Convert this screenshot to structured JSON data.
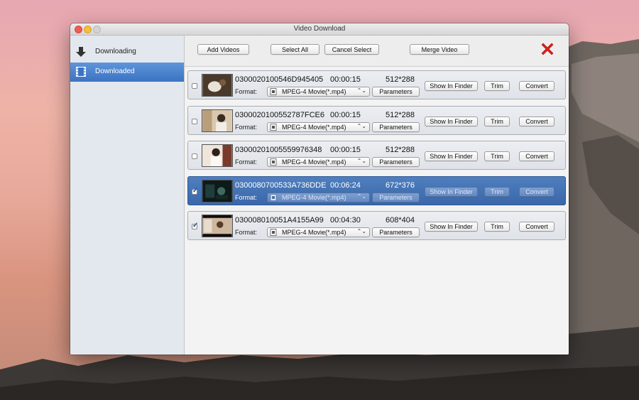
{
  "window": {
    "title": "Video Download"
  },
  "sidebar": {
    "items": [
      {
        "label": "Downloading",
        "icon": "download-arrow-icon"
      },
      {
        "label": "Downloaded",
        "icon": "film-icon"
      }
    ]
  },
  "toolbar": {
    "add_videos": "Add Videos",
    "select_all": "Select All",
    "cancel_select": "Cancel Select",
    "merge_video": "Merge Video",
    "delete_icon": "red-x-icon"
  },
  "rows": [
    {
      "name": "0300020100546D945405",
      "duration": "00:00:15",
      "resolution": "512*288",
      "format_label": "Format:",
      "format": "MPEG-4 Movie(*.mp4)",
      "parameters": "Parameters",
      "show_in_finder": "Show In Finder",
      "trim": "Trim",
      "convert": "Convert",
      "checked": false,
      "selected": false
    },
    {
      "name": "0300020100552787FCE6",
      "duration": "00:00:15",
      "resolution": "512*288",
      "format_label": "Format:",
      "format": "MPEG-4 Movie(*.mp4)",
      "parameters": "Parameters",
      "show_in_finder": "Show In Finder",
      "trim": "Trim",
      "convert": "Convert",
      "checked": false,
      "selected": false
    },
    {
      "name": "030002010055599763​48",
      "duration": "00:00:15",
      "resolution": "512*288",
      "format_label": "Format:",
      "format": "MPEG-4 Movie(*.mp4)",
      "parameters": "Parameters",
      "show_in_finder": "Show In Finder",
      "trim": "Trim",
      "convert": "Convert",
      "checked": false,
      "selected": false
    },
    {
      "name": "0300080700533A736DDE",
      "duration": "00:06:24",
      "resolution": "672*376",
      "format_label": "Format:",
      "format": "MPEG-4 Movie(*.mp4)",
      "parameters": "Parameters",
      "show_in_finder": "Show In Finder",
      "trim": "Trim",
      "convert": "Convert",
      "checked": true,
      "selected": true
    },
    {
      "name": "030008010051A4155A99",
      "duration": "00:04:30",
      "resolution": "608*404",
      "format_label": "Format:",
      "format": "MPEG-4 Movie(*.mp4)",
      "parameters": "Parameters",
      "show_in_finder": "Show In Finder",
      "trim": "Trim",
      "convert": "Convert",
      "checked": true,
      "selected": false
    }
  ],
  "colors": {
    "accent": "#3b73c4",
    "delete": "#d9211c"
  }
}
